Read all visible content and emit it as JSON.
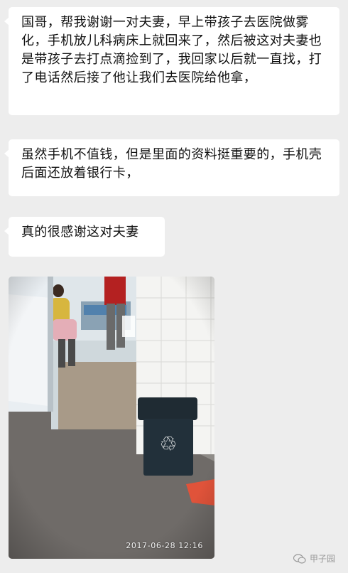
{
  "messages": [
    {
      "text": "国哥，帮我谢谢一对夫妻，早上带孩子去医院做雾化，手机放儿科病床上就回来了，然后被这对夫妻也是带孩子去打点滴捡到了，我回家以后就一直找，打了电话然后接了他让我们去医院给他拿，"
    },
    {
      "text": "虽然手机不值钱，但是里面的资料挺重要的，手机壳后面还放着银行卡，"
    },
    {
      "text": "真的很感谢这对夫妻"
    }
  ],
  "photo": {
    "timestamp": "2017-06-28  12:16",
    "bin_symbol": "♲"
  },
  "watermark": {
    "icon": "wechat-icon",
    "text": "甲子园"
  },
  "colors": {
    "background": "#ededed",
    "bubble": "#ffffff",
    "text": "#111111"
  }
}
